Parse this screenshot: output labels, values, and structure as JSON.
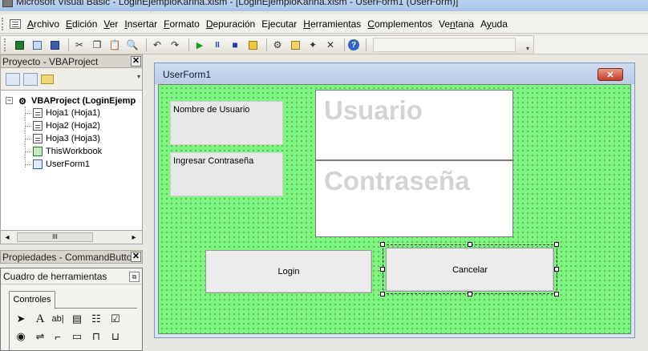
{
  "window": {
    "title": "Microsoft Visual Basic - LoginEjemploKarina.xlsm - [LoginEjemploKarina.xlsm - UserForm1 (UserForm)]"
  },
  "menu": {
    "items": [
      {
        "label": "Archivo",
        "key": "A"
      },
      {
        "label": "Edición",
        "key": "E"
      },
      {
        "label": "Ver",
        "key": "V"
      },
      {
        "label": "Insertar",
        "key": "I"
      },
      {
        "label": "Formato",
        "key": "F"
      },
      {
        "label": "Depuración",
        "key": "D"
      },
      {
        "label": "Ejecutar",
        "key": "j"
      },
      {
        "label": "Herramientas",
        "key": "H"
      },
      {
        "label": "Complementos",
        "key": "C"
      },
      {
        "label": "Ventana",
        "key": "n"
      },
      {
        "label": "Ayuda",
        "key": "y"
      }
    ]
  },
  "toolbar": {
    "icons": [
      "excel-icon",
      "insert-icon",
      "save-icon",
      "cut-icon",
      "copy-icon",
      "paste-icon",
      "find-icon",
      "undo-icon",
      "redo-icon",
      "run-icon",
      "pause-icon",
      "reset-icon",
      "design-mode-icon",
      "project-explorer-icon",
      "properties-icon",
      "object-browser-icon",
      "toolbox-icon",
      "help-icon"
    ]
  },
  "project_pane": {
    "title": "Proyecto - VBAProject",
    "tree": [
      {
        "label": "VBAProject (LoginEjemp",
        "level": 0,
        "icon": "project-icon",
        "bold": true
      },
      {
        "label": "Hoja1 (Hoja1)",
        "level": 1,
        "icon": "sheet-icon"
      },
      {
        "label": "Hoja2 (Hoja2)",
        "level": 1,
        "icon": "sheet-icon"
      },
      {
        "label": "Hoja3 (Hoja3)",
        "level": 1,
        "icon": "sheet-icon"
      },
      {
        "label": "ThisWorkbook",
        "level": 1,
        "icon": "workbook-icon"
      },
      {
        "label": "UserForm1",
        "level": 1,
        "icon": "userform-icon"
      }
    ],
    "scroll_thumb": "III"
  },
  "properties_pane": {
    "title": "Propiedades - CommandButto"
  },
  "toolbox": {
    "title": "Cuadro de herramientas",
    "tab": "Controles",
    "controls": [
      "pointer-icon",
      "label-icon",
      "textbox-icon",
      "combobox-icon",
      "listbox-icon",
      "checkbox-icon",
      "optionbutton-icon",
      "togglebutton-icon",
      "frame-icon",
      "commandbutton-icon",
      "tabstrip-icon",
      "multipage-icon"
    ],
    "glyphs": {
      "label": "A",
      "textbox": "ab|"
    }
  },
  "userform": {
    "title": "UserForm1",
    "close_glyph": "✕",
    "label_user": "Nombre de Usuario",
    "label_pass": "Ingresar Contraseña",
    "textbox_user": "Usuario",
    "textbox_pass": "Contraseña",
    "btn_login": "Login",
    "btn_cancel": "Cancelar",
    "colors": {
      "surface": "#7ef57e",
      "grid_dot": "#0f3a0f"
    }
  }
}
